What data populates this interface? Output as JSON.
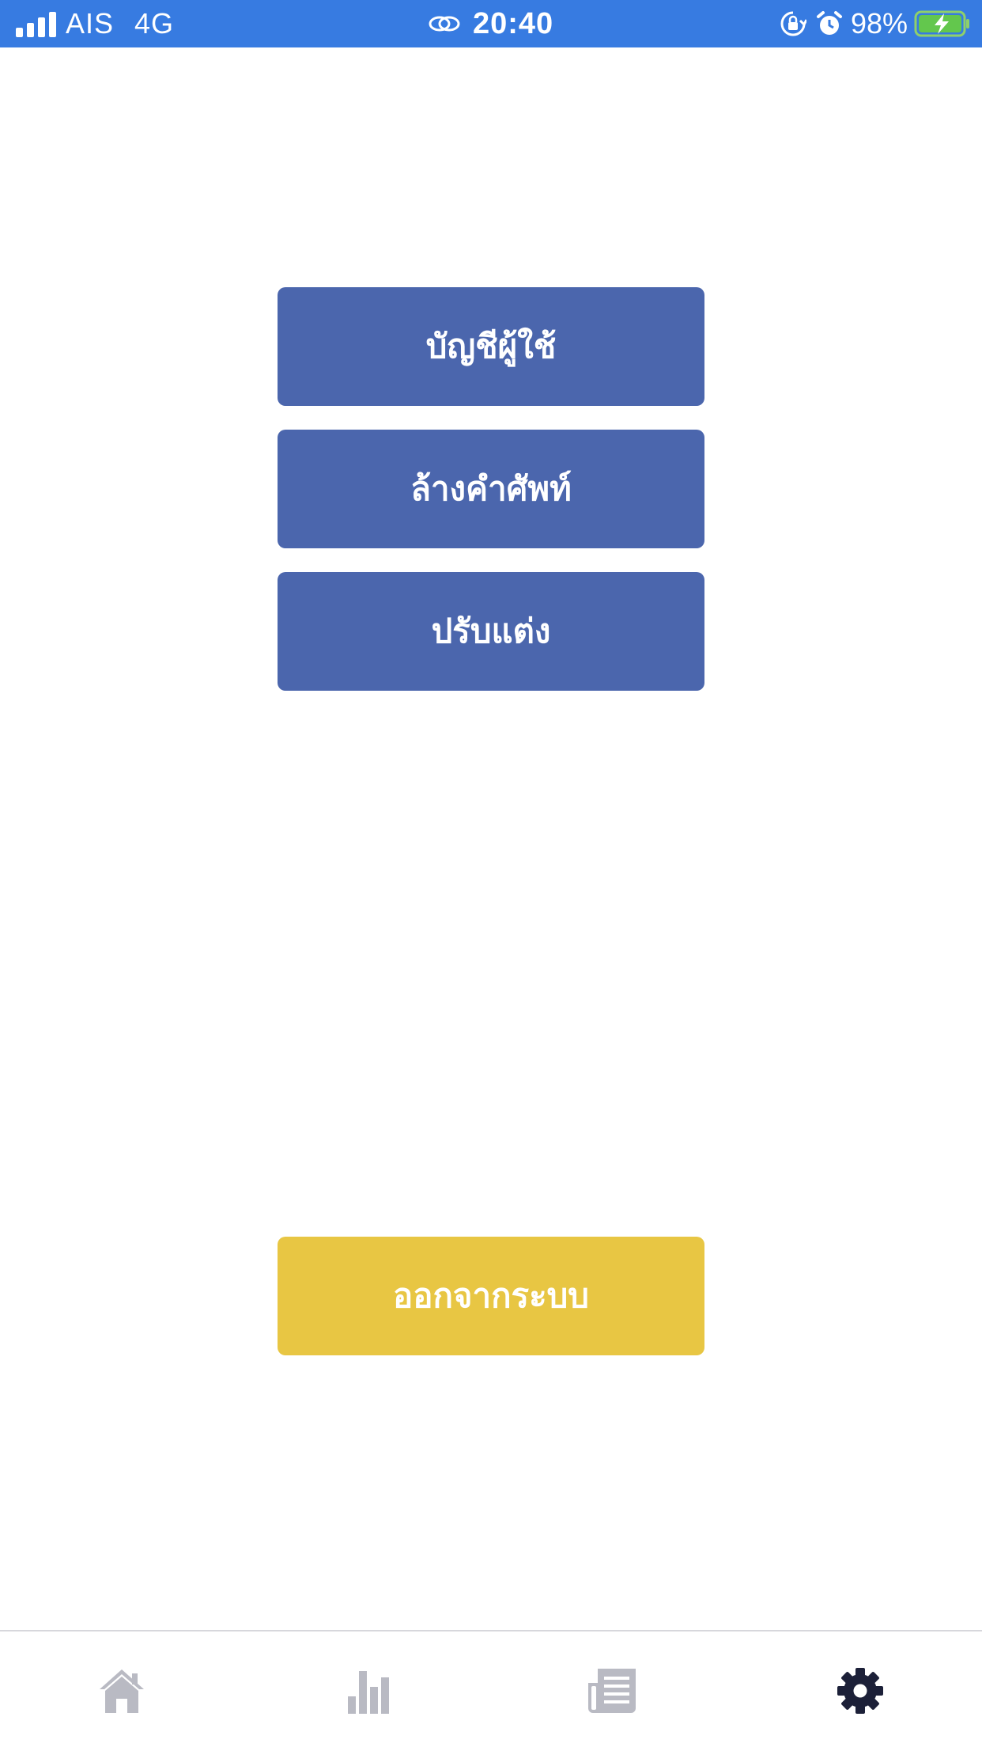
{
  "status_bar": {
    "carrier": "AIS",
    "network": "4G",
    "time": "20:40",
    "battery": "98%",
    "background_color": "#377be1"
  },
  "menu": {
    "account_label": "บัญชีผู้ใช้",
    "clear_vocab_label": "ล้างคำศัพท์",
    "customize_label": "ปรับแต่ง",
    "button_color": "#4b66ad"
  },
  "logout": {
    "label": "ออกจากระบบ",
    "color": "#e8c643"
  },
  "tab_bar": {
    "items": [
      {
        "icon": "home-icon",
        "active": false
      },
      {
        "icon": "bar-chart-icon",
        "active": false
      },
      {
        "icon": "newspaper-icon",
        "active": false
      },
      {
        "icon": "gear-icon",
        "active": true
      }
    ],
    "inactive_color": "#b9bac3",
    "active_color": "#1c2038"
  }
}
